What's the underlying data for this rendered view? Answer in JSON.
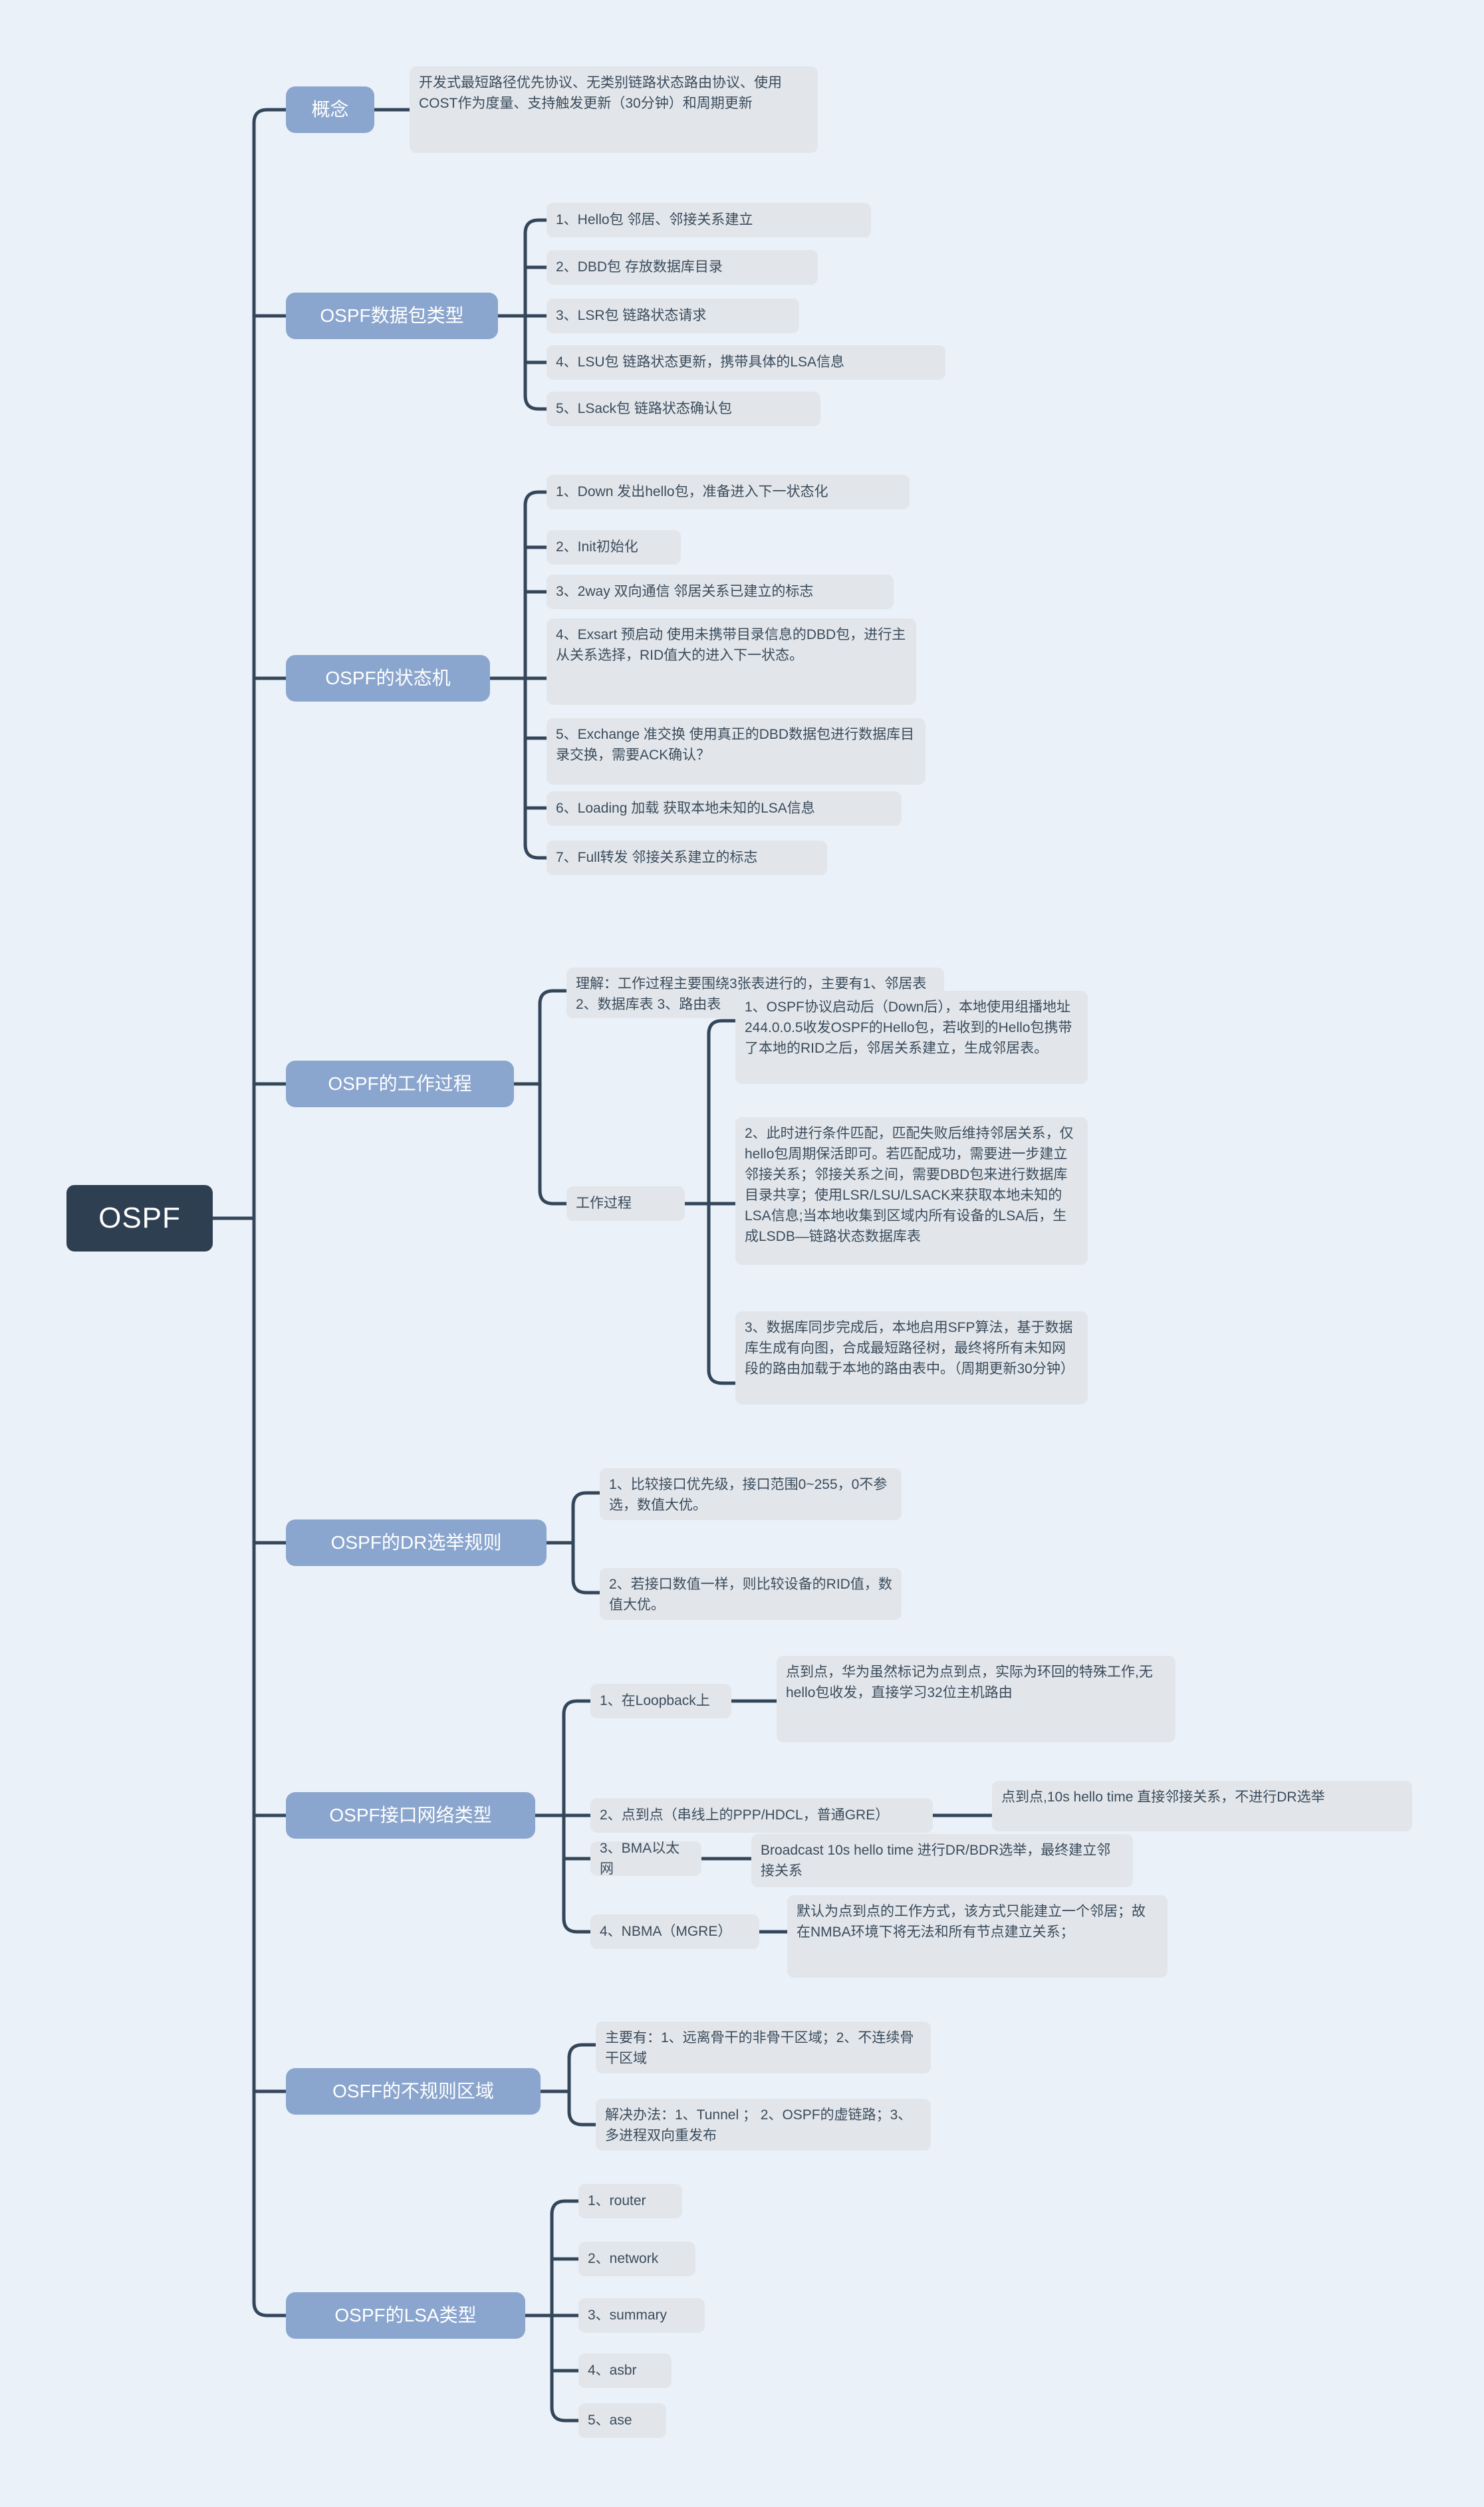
{
  "root": {
    "label": "OSPF"
  },
  "branches": [
    {
      "id": "concept",
      "label": "概念",
      "children": [
        {
          "text": "开发式最短路径优先协议、无类别链路状态路由协议、使用COST作为度量、支持触发更新（30分钟）和周期更新"
        }
      ]
    },
    {
      "id": "packet-types",
      "label": "OSPF数据包类型",
      "children": [
        {
          "text": "1、Hello包  邻居、邻接关系建立"
        },
        {
          "text": "2、DBD包 存放数据库目录"
        },
        {
          "text": "3、LSR包  链路状态请求"
        },
        {
          "text": "4、LSU包  链路状态更新，携带具体的LSA信息"
        },
        {
          "text": "5、LSack包 链路状态确认包"
        }
      ]
    },
    {
      "id": "state-machine",
      "label": "OSPF的状态机",
      "children": [
        {
          "text": "1、Down  发出hello包，准备进入下一状态化"
        },
        {
          "text": "2、Init初始化"
        },
        {
          "text": "3、2way 双向通信 邻居关系已建立的标志"
        },
        {
          "text": "4、Exsart 预启动 使用未携带目录信息的DBD包，进行主从关系选择，RID值大的进入下一状态。"
        },
        {
          "text": "5、Exchange 准交换 使用真正的DBD数据包进行数据库目录交换，需要ACK确认？"
        },
        {
          "text": "6、Loading 加载 获取本地未知的LSA信息"
        },
        {
          "text": "7、Full转发 邻接关系建立的标志"
        }
      ]
    },
    {
      "id": "work-process",
      "label": "OSPF的工作过程",
      "children": [
        {
          "text": "理解：工作过程主要围绕3张表进行的，主要有1、邻居表    2、数据库表    3、路由表"
        },
        {
          "text": "工作过程",
          "children": [
            {
              "text": "1、OSPF协议启动后（Down后），本地使用组播地址244.0.0.5收发OSPF的Hello包，若收到的Hello包携带了本地的RID之后，邻居关系建立，生成邻居表。"
            },
            {
              "text": "2、此时进行条件匹配，匹配失败后维持邻居关系，仅hello包周期保活即可。若匹配成功，需要进一步建立邻接关系；邻接关系之间，需要DBD包来进行数据库目录共享；使用LSR/LSU/LSACK来获取本地未知的LSA信息;当本地收集到区域内所有设备的LSA后，生成LSDB—链路状态数据库表"
            },
            {
              "text": "3、数据库同步完成后，本地启用SFP算法，基于数据库生成有向图，合成最短路径树，最终将所有未知网段的路由加载于本地的路由表中。（周期更新30分钟）"
            }
          ]
        }
      ]
    },
    {
      "id": "dr-election",
      "label": "OSPF的DR选举规则",
      "children": [
        {
          "text": "1、比较接口优先级，接口范围0~255，0不参选，数值大优。"
        },
        {
          "text": "2、若接口数值一样，则比较设备的RID值，数值大优。"
        }
      ]
    },
    {
      "id": "interface-network-types",
      "label": "OSPF接口网络类型",
      "children": [
        {
          "text": "1、在Loopback上",
          "children": [
            {
              "text": "点到点，华为虽然标记为点到点，实际为环回的特殊工作,无hello包收发，直接学习32位主机路由"
            }
          ]
        },
        {
          "text": "2、点到点（串线上的PPP/HDCL，普通GRE）",
          "children": [
            {
              "text": "点到点,10s hello time 直接邻接关系，不进行DR选举"
            }
          ]
        },
        {
          "text": "3、BMA以太网",
          "children": [
            {
              "text": "Broadcast   10s hello time  进行DR/BDR选举，最终建立邻接关系"
            }
          ]
        },
        {
          "text": "4、NBMA（MGRE）",
          "children": [
            {
              "text": "默认为点到点的工作方式，该方式只能建立一个邻居；故在NMBA环境下将无法和所有节点建立关系；"
            }
          ]
        }
      ]
    },
    {
      "id": "irregular-areas",
      "label": "OSFF的不规则区域",
      "children": [
        {
          "text": "主要有：1、远离骨干的非骨干区域；2、不连续骨干区域"
        },
        {
          "text": "解决办法：1、Tunnel  ； 2、OSPF的虚链路；3、多进程双向重发布"
        }
      ]
    },
    {
      "id": "lsa-types",
      "label": "OSPF的LSA类型",
      "children": [
        {
          "text": "1、router"
        },
        {
          "text": "2、network"
        },
        {
          "text": "3、summary"
        },
        {
          "text": "4、asbr"
        },
        {
          "text": "5、ase"
        }
      ]
    }
  ],
  "colors": {
    "background": "#eaf1f8",
    "root_bg": "#2e3f51",
    "branch_bg": "#8ba6ce",
    "leaf_bg": "#e2e6ea",
    "leaf_text": "#3b4b5c",
    "wire": "#34465a"
  }
}
